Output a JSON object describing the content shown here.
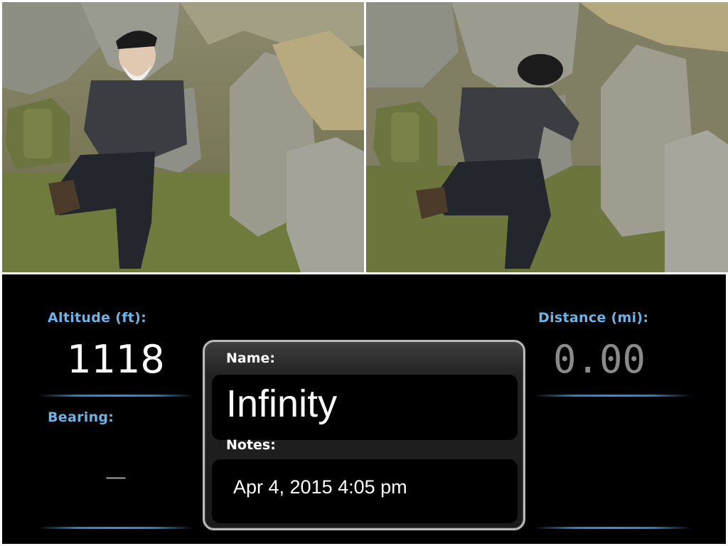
{
  "photos": {
    "left": {
      "name": "man-kneeling-by-rocks-photo"
    },
    "right": {
      "name": "man-reaching-into-rocks-photo"
    }
  },
  "altitude": {
    "label": "Altitude (ft):",
    "value": "1118",
    "color": "#ffffff"
  },
  "bearing": {
    "label": "Bearing:",
    "value": "—",
    "color": "#9a9a9a"
  },
  "distance": {
    "label": "Distance (mi):",
    "value": "0.00",
    "color": "#8a8a8a"
  },
  "waypoint": {
    "name_label": "Name:",
    "name_value": "Infinity",
    "notes_label": "Notes:",
    "notes_value": "Apr 4, 2015  4:05 pm"
  },
  "colors": {
    "label_blue": "#6fb2e6",
    "panel_bg": "#000000",
    "divider_blue": "#2f7fc0"
  }
}
